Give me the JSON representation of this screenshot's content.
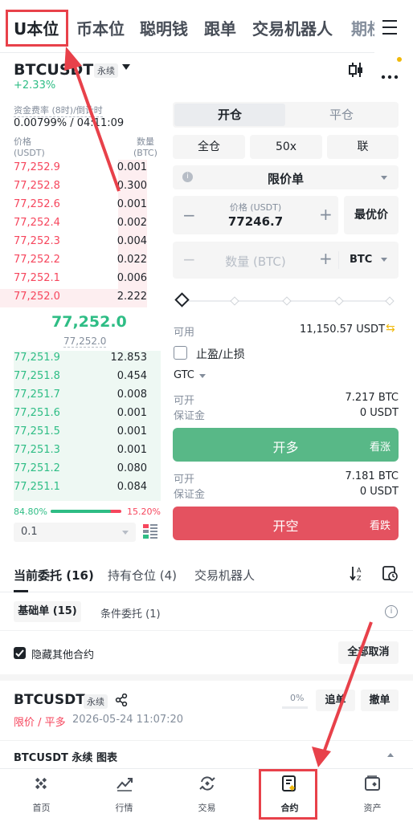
{
  "topnav": {
    "tabs": [
      "U本位",
      "币本位",
      "聪明钱",
      "跟单",
      "交易机器人",
      "期权"
    ],
    "menu_icon": "hamburger-icon"
  },
  "header": {
    "symbol": "BTCUSDT",
    "type_badge": "永续",
    "change": "+2.33%",
    "chart_icon": "candlestick-icon",
    "more_icon": "more-dots-icon"
  },
  "funding": {
    "label": "资金费率 (8时)/倒计时",
    "value": "0.00799% / 04:11:09"
  },
  "orderbook": {
    "price_header": "价格",
    "price_unit": "(USDT)",
    "qty_header": "数量",
    "qty_unit": "(BTC)",
    "asks": [
      {
        "p": "77,252.9",
        "q": "0.001"
      },
      {
        "p": "77,252.8",
        "q": "0.300"
      },
      {
        "p": "77,252.6",
        "q": "0.001"
      },
      {
        "p": "77,252.4",
        "q": "0.002"
      },
      {
        "p": "77,252.3",
        "q": "0.004"
      },
      {
        "p": "77,252.2",
        "q": "0.022"
      },
      {
        "p": "77,252.1",
        "q": "0.006"
      },
      {
        "p": "77,252.0",
        "q": "2.222"
      }
    ],
    "last_price": "77,252.0",
    "mark_price": "77,252.0",
    "bids": [
      {
        "p": "77,251.9",
        "q": "12.853"
      },
      {
        "p": "77,251.8",
        "q": "0.454"
      },
      {
        "p": "77,251.7",
        "q": "0.008"
      },
      {
        "p": "77,251.6",
        "q": "0.001"
      },
      {
        "p": "77,251.5",
        "q": "0.001"
      },
      {
        "p": "77,251.3",
        "q": "0.001"
      },
      {
        "p": "77,251.2",
        "q": "0.080"
      },
      {
        "p": "77,251.1",
        "q": "0.084"
      }
    ],
    "buy_ratio": "84.80%",
    "sell_ratio": "15.20%",
    "buy_fraction": 0.848,
    "precision": "0.1"
  },
  "form": {
    "open_tab": "开仓",
    "close_tab": "平仓",
    "margin_mode": "全仓",
    "leverage": "50x",
    "link": "联",
    "order_type": "限价单",
    "price_label": "价格 (USDT)",
    "price_value": "77246.7",
    "best_price": "最优价",
    "qty_placeholder": "数量 (BTC)",
    "qty_unit": "BTC",
    "avail_label": "可用",
    "avail_value": "11,150.57 USDT",
    "tpsl": "止盈/止损",
    "tif": "GTC",
    "long_can_open_label": "可开",
    "long_can_open": "7.217 BTC",
    "long_margin_label": "保证金",
    "long_margin": "0 USDT",
    "buy_btn": "开多",
    "buy_sub": "看涨",
    "short_can_open_label": "可开",
    "short_can_open": "7.181 BTC",
    "short_margin_label": "保证金",
    "short_margin": "0 USDT",
    "sell_btn": "开空",
    "sell_sub": "看跌"
  },
  "orders": {
    "tabs": [
      "当前委托 (16)",
      "持有仓位 (4)",
      "交易机器人"
    ],
    "sub_tabs": [
      "基础单 (15)",
      "条件委托 (1)"
    ],
    "hide_other": "隐藏其他合约",
    "cancel_all": "全部取消",
    "item": {
      "symbol": "BTCUSDT",
      "badge": "永续",
      "type": "限价 / 平多",
      "time": "2026-05-24 11:07:20",
      "progress": "0%",
      "chase": "追单",
      "cancel": "撤单"
    },
    "chart_bar": "BTCUSDT 永续 图表"
  },
  "bottom_nav": [
    "首页",
    "行情",
    "交易",
    "合约",
    "资产"
  ],
  "colors": {
    "green": "#2ebd85",
    "red": "#f6465d",
    "highlight": "#e8414a",
    "buy_btn": "#58b887",
    "sell_btn": "#e45260"
  }
}
